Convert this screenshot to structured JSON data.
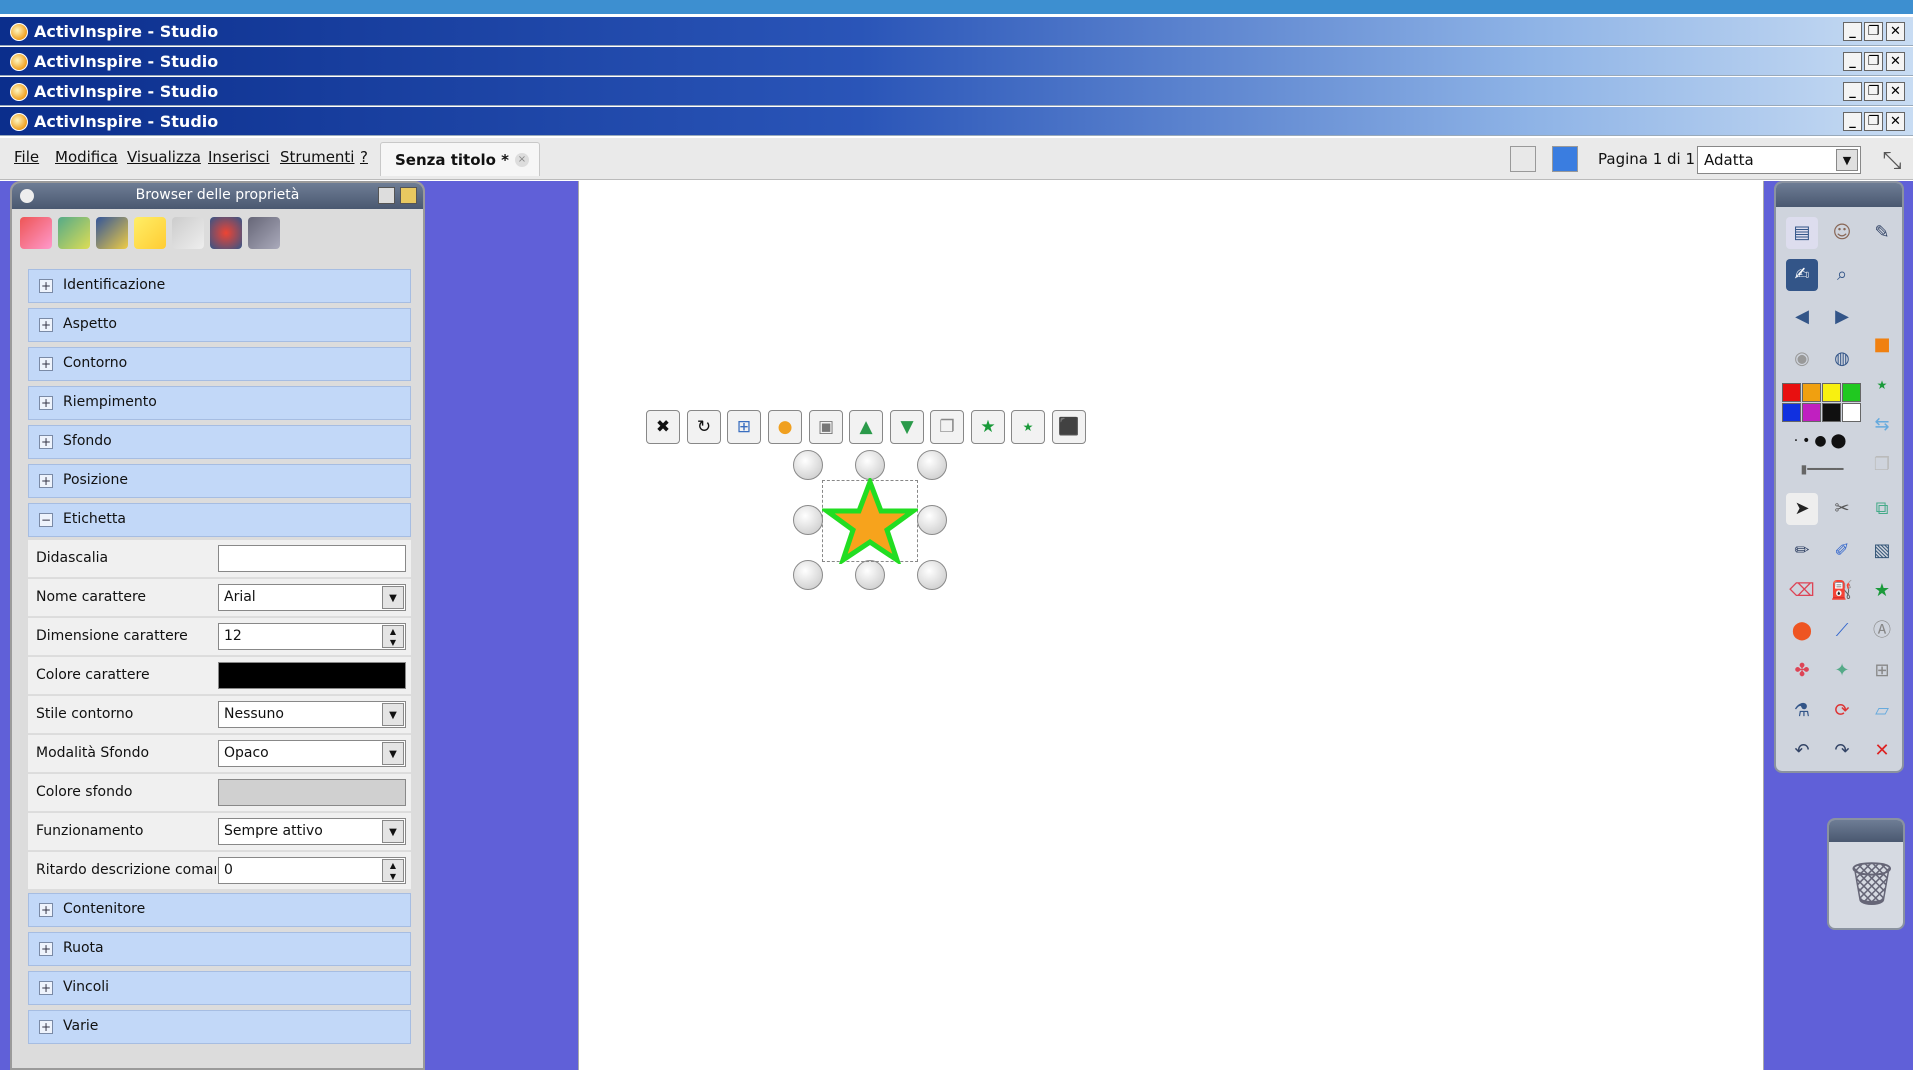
{
  "windows": [
    {
      "title": "ActivInspire - Studio"
    },
    {
      "title": "ActivInspire - Studio"
    },
    {
      "title": "ActivInspire - Studio"
    },
    {
      "title": "ActivInspire - Studio"
    }
  ],
  "window_controls": {
    "minimize": "_",
    "restore": "❐",
    "close": "✕"
  },
  "menu": {
    "items": [
      "File",
      "Modifica",
      "Visualizza",
      "Inserisci",
      "Strumenti",
      "?"
    ]
  },
  "doc_tab": {
    "label": "Senza titolo *",
    "close": "×"
  },
  "toolbar": {
    "page_indicator": "Pagina 1 di 1",
    "zoom_value": "Adatta"
  },
  "property_browser": {
    "title": "Browser delle proprietà",
    "sections_top": [
      "Identificazione",
      "Aspetto",
      "Contorno",
      "Riempimento",
      "Sfondo",
      "Posizione"
    ],
    "expanded_section": "Etichetta",
    "properties": [
      {
        "label": "Didascalia",
        "value": ""
      },
      {
        "label": "Nome carattere",
        "value": "Arial"
      },
      {
        "label": "Dimensione carattere",
        "value": "12"
      },
      {
        "label": "Colore carattere",
        "value": ""
      },
      {
        "label": "Stile contorno",
        "value": "Nessuno"
      },
      {
        "label": "Modalità Sfondo",
        "value": "Opaco"
      },
      {
        "label": "Colore sfondo",
        "value": ""
      },
      {
        "label": "Funzionamento",
        "value": "Sempre attivo"
      },
      {
        "label": "Ritardo descrizione comandi",
        "value": "0"
      }
    ],
    "sections_bottom": [
      "Contenitore",
      "Ruota",
      "Vincoli",
      "Varie"
    ]
  },
  "colors": {
    "font_color": "#000000",
    "bg_color": "#d0d0d0",
    "star_fill": "#f7a31c",
    "star_stroke": "#22dd22",
    "palette": [
      "#e81010",
      "#f0a010",
      "#f8f010",
      "#20c820",
      "#1030e0",
      "#c020c0",
      "#101010",
      "#ffffff"
    ]
  },
  "icons": {
    "property_browser_tabs": [
      "page-browser-icon",
      "resource-browser-icon",
      "object-browser-icon",
      "notes-browser-icon",
      "property-browser-icon",
      "action-browser-icon",
      "voting-browser-icon"
    ],
    "object_toolbar": [
      "close-icon",
      "rotate-icon",
      "align-icon",
      "color-icon",
      "layer-icon",
      "bring-front-icon",
      "send-back-icon",
      "duplicate-icon",
      "star-menu-icon",
      "star-small-icon",
      "resize-icon"
    ],
    "toolbox": [
      "page-icon",
      "user-icon",
      "pen-settings-icon",
      "desktop-annotate-icon",
      "zoom-icon",
      "previous-page-icon",
      "next-page-icon",
      "play-icon",
      "globe-icon",
      "select-icon",
      "magic-ink-icon",
      "pen-icon",
      "highlighter-icon",
      "eraser-icon",
      "fill-icon",
      "shape-icon",
      "connector-icon",
      "clipart-icon",
      "resource-icon",
      "lock-icon",
      "reset-icon",
      "undo-icon",
      "redo-icon",
      "delete-icon"
    ]
  }
}
